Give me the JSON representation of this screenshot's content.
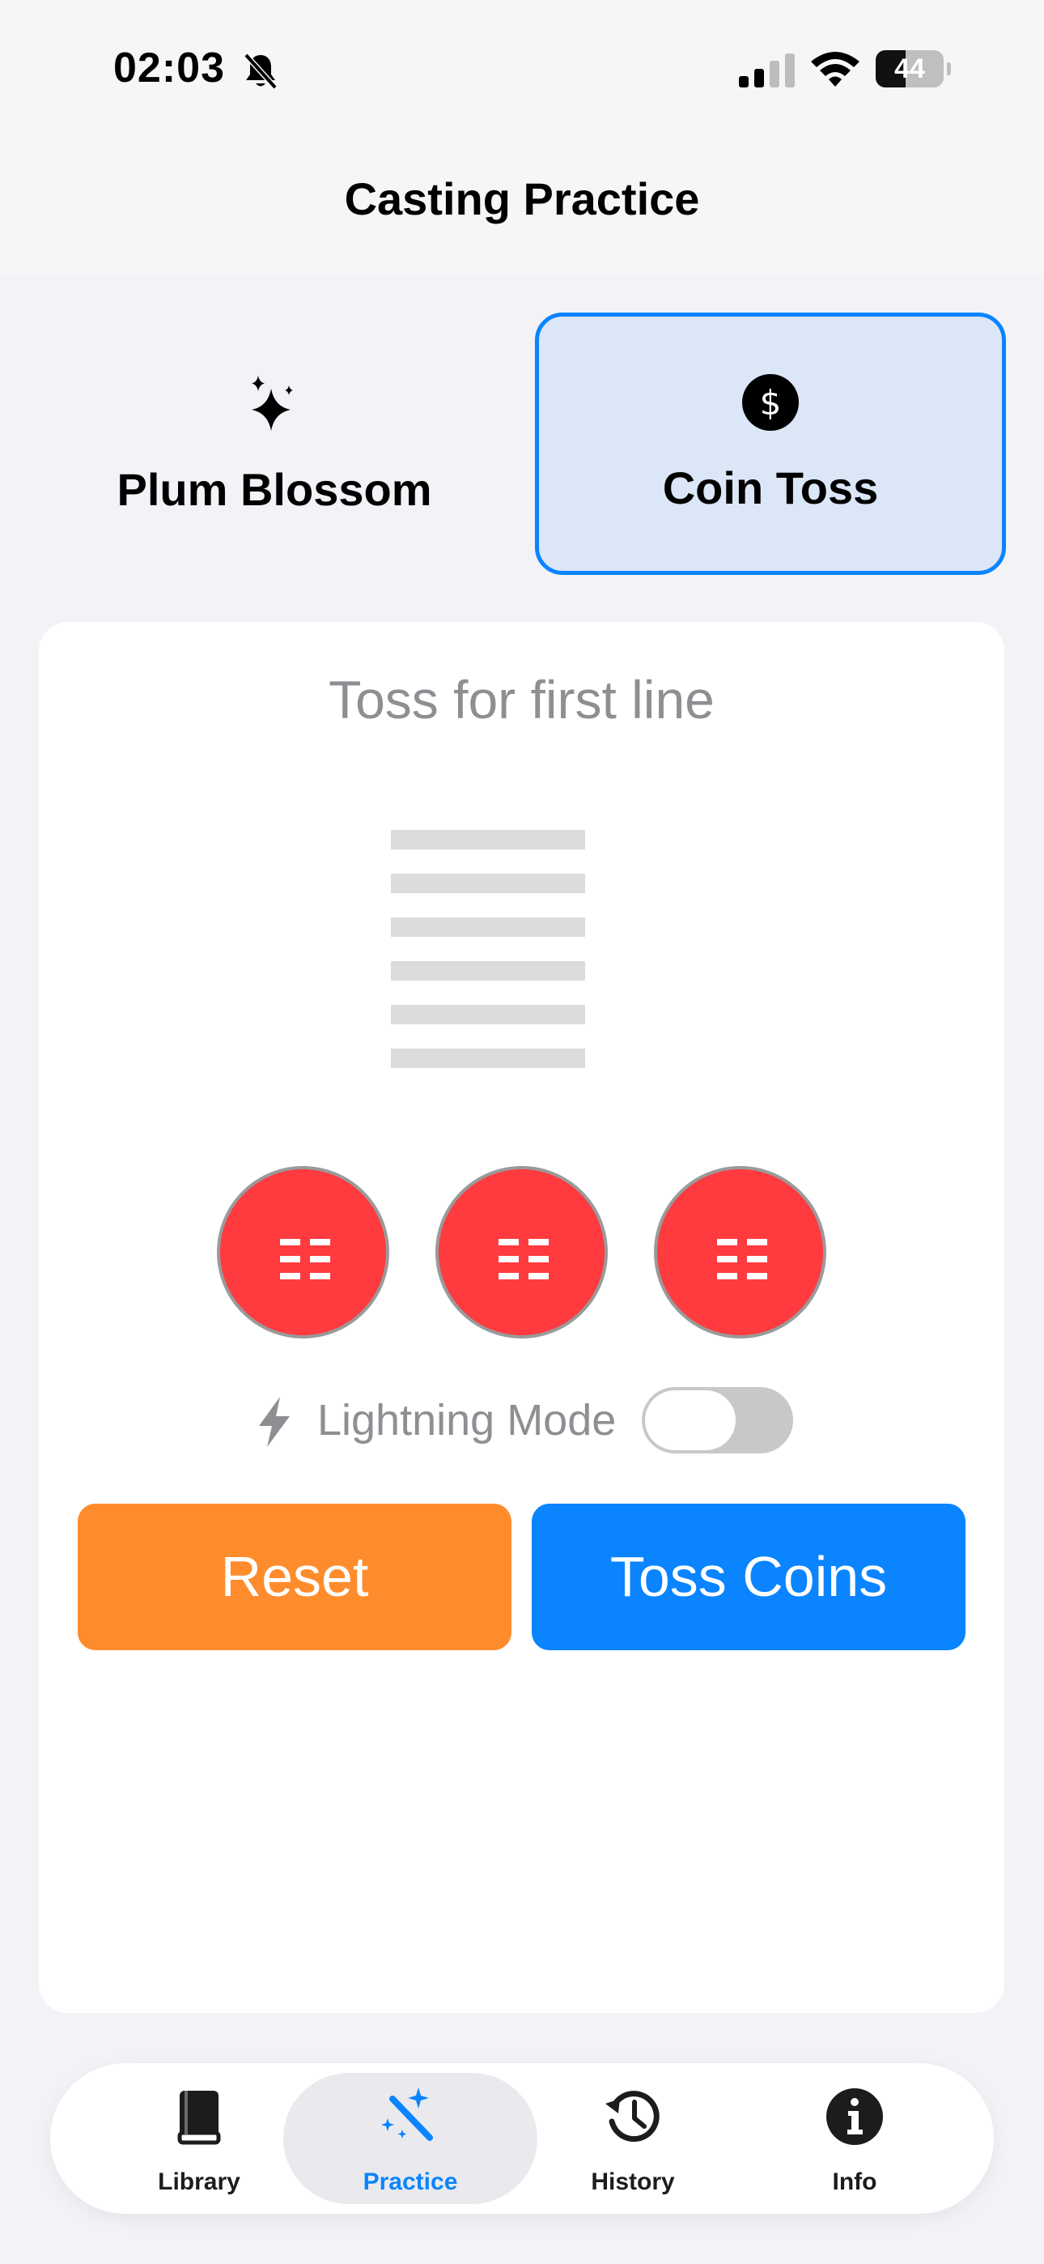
{
  "status_bar": {
    "time": "02:03",
    "battery_level": "44",
    "battery_fraction": 0.44
  },
  "nav": {
    "title": "Casting Practice"
  },
  "methods": [
    {
      "label": "Plum Blossom",
      "icon": "sparkles-icon",
      "selected": false
    },
    {
      "label": "Coin Toss",
      "icon": "dollar-coin-icon",
      "selected": true
    }
  ],
  "practice": {
    "prompt": "Toss for first line",
    "hexagram_lines": 6,
    "coins": [
      {
        "face": "trigram-icon",
        "color": "#ff3b3f"
      },
      {
        "face": "trigram-icon",
        "color": "#ff3b3f"
      },
      {
        "face": "trigram-icon",
        "color": "#ff3b3f"
      }
    ],
    "lightning_mode_label": "Lightning Mode",
    "lightning_mode_on": false,
    "reset_label": "Reset",
    "toss_label": "Toss Coins"
  },
  "tab_bar": {
    "items": [
      {
        "label": "Library",
        "icon": "book-icon",
        "active": false
      },
      {
        "label": "Practice",
        "icon": "magic-wand-icon",
        "active": true
      },
      {
        "label": "History",
        "icon": "history-clock-icon",
        "active": false
      },
      {
        "label": "Info",
        "icon": "info-icon",
        "active": false
      }
    ]
  },
  "colors": {
    "accent": "#0a84ff",
    "reset": "#ff8c2c",
    "coin": "#ff3b3f",
    "background": "#f2f2f7"
  }
}
